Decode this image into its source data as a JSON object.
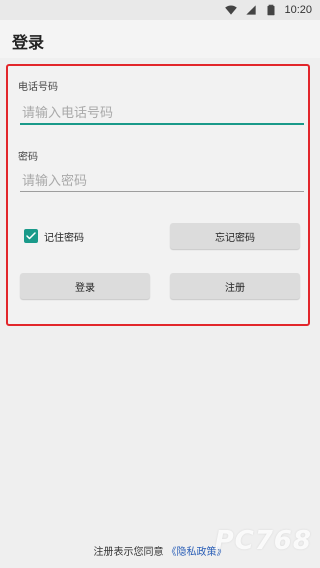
{
  "status_bar": {
    "time": "10:20",
    "icons": [
      "wifi-icon",
      "signal-icon",
      "battery-icon"
    ]
  },
  "app_bar": {
    "title": "登录"
  },
  "form": {
    "phone_label": "电话号码",
    "phone_placeholder": "请输入电话号码",
    "phone_value": "",
    "password_label": "密码",
    "password_placeholder": "请输入密码",
    "password_value": "",
    "remember_label": "记住密码",
    "remember_checked": true,
    "forgot_button": "忘记密码",
    "login_button": "登录",
    "register_button": "注册"
  },
  "footer": {
    "text": "注册表示您同意",
    "link": "《隐私政策》"
  },
  "watermark": "PC768",
  "colors": {
    "accent": "#1a9a8a",
    "highlight_border": "#e2262b",
    "link": "#2b5fb7"
  }
}
